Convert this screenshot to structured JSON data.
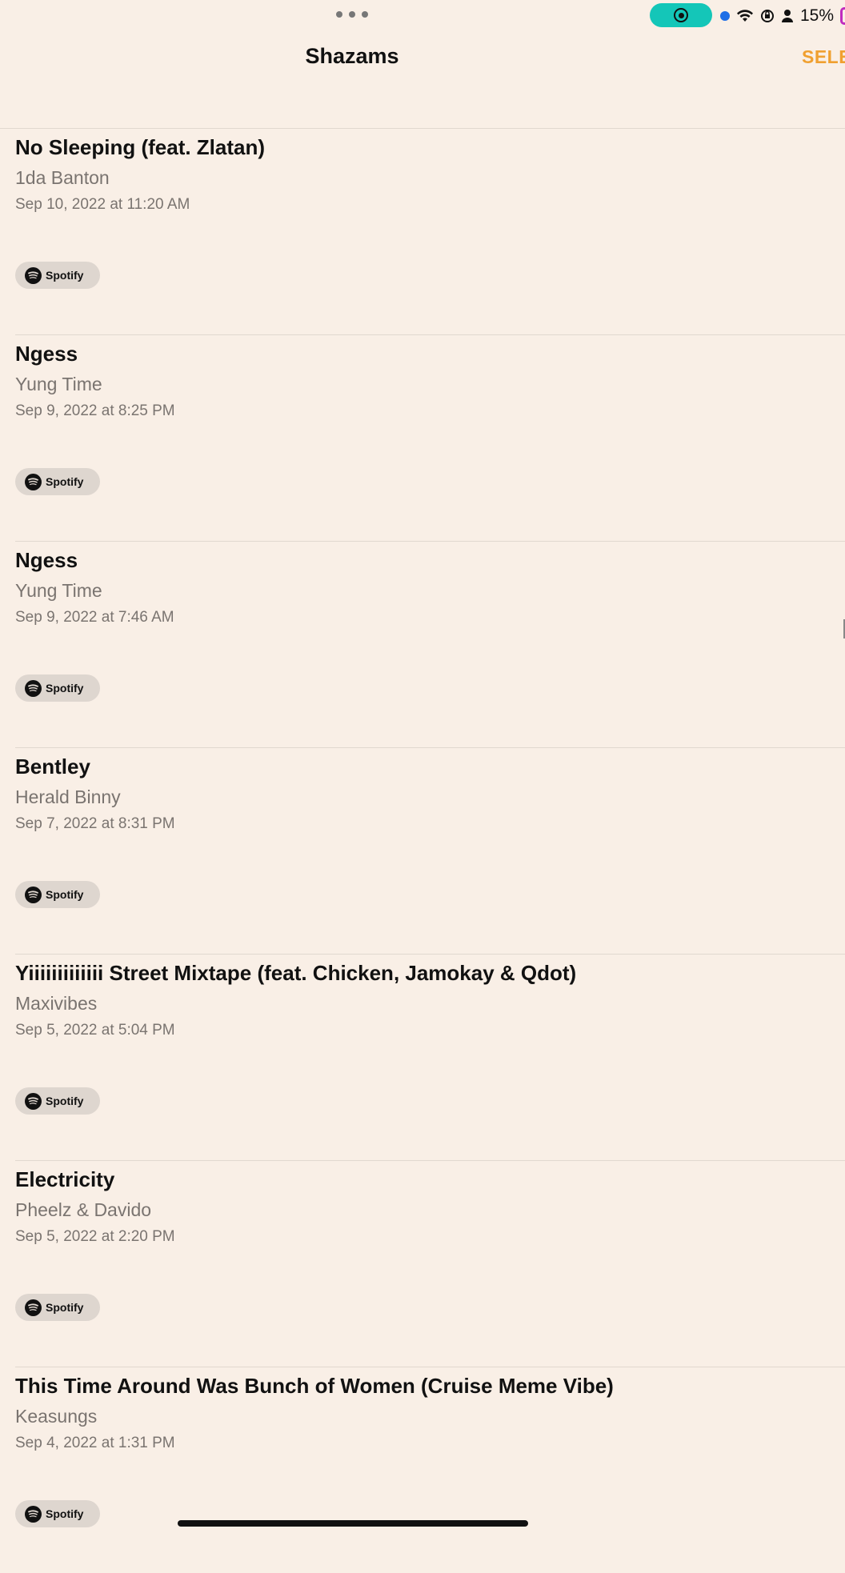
{
  "status_bar": {
    "battery": "15%",
    "colors": {
      "record": "#14c6b8",
      "location_dot": "#1e6ee6",
      "battery_outline": "#c02bbf"
    }
  },
  "header": {
    "title": "Shazams",
    "select_label": "SELE",
    "accent_color": "#f0a030"
  },
  "items": [
    {
      "title": "No Sleeping (feat. Zlatan)",
      "artist": "1da Banton",
      "date": "Sep 10, 2022 at 11:20 AM",
      "provider": "Spotify"
    },
    {
      "title": "Ngess",
      "artist": "Yung Time",
      "date": "Sep 9, 2022 at 8:25 PM",
      "provider": "Spotify"
    },
    {
      "title": "Ngess",
      "artist": "Yung Time",
      "date": "Sep 9, 2022 at 7:46 AM",
      "provider": "Spotify"
    },
    {
      "title": "Bentley",
      "artist": "Herald Binny",
      "date": "Sep 7, 2022 at 8:31 PM",
      "provider": "Spotify"
    },
    {
      "title": "Yiiiiiiiiiiiii Street Mixtape (feat. Chicken, Jamokay & Qdot)",
      "artist": "Maxivibes",
      "date": "Sep 5, 2022 at 5:04 PM",
      "provider": "Spotify"
    },
    {
      "title": "Electricity",
      "artist": "Pheelz & Davido",
      "date": "Sep 5, 2022 at 2:20 PM",
      "provider": "Spotify"
    },
    {
      "title": "This Time Around Was Bunch of Women (Cruise Meme Vibe)",
      "artist": "Keasungs",
      "date": "Sep 4, 2022 at 1:31 PM",
      "provider": "Spotify"
    }
  ]
}
